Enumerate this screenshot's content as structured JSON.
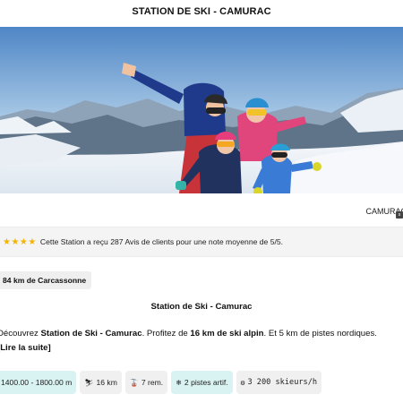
{
  "page": {
    "title": "STATION DE SKI - CAMURAC"
  },
  "hero": {
    "location_label": "CAMURAC",
    "tip_glyph": "s"
  },
  "rating": {
    "stars": "★★★★",
    "text": "Cette Station a reçu 287 Avis de clients pour une note moyenne de 5/5."
  },
  "distance": {
    "text": "84 km de Carcassonne"
  },
  "section": {
    "title": "Station de Ski - Camurac"
  },
  "description": {
    "part1": "Découvrez ",
    "name": "Station de Ski - Camurac",
    "part2": ". Profitez de ",
    "alpine": "16 km de ski alpin",
    "part3": ". Et 5 km de pistes nordiques.",
    "read_more": "[Lire la suite]"
  },
  "stats": {
    "altitude": "1400.00 - 1800.00 m",
    "alpine_km": "16 km",
    "lifts": "7 rem.",
    "artificial_pistes": "2 pistes artif.",
    "skiers": "3 200 skieurs/h"
  },
  "icons": {
    "skier_icon": "⛷",
    "lift_icon": "🚡",
    "snowflake_icon": "❄",
    "gear_icon": "⚙"
  },
  "colors": {
    "star": "#f5b301",
    "chip_teal": "#d9f2f2",
    "chip_grey": "#f0f0f0"
  }
}
